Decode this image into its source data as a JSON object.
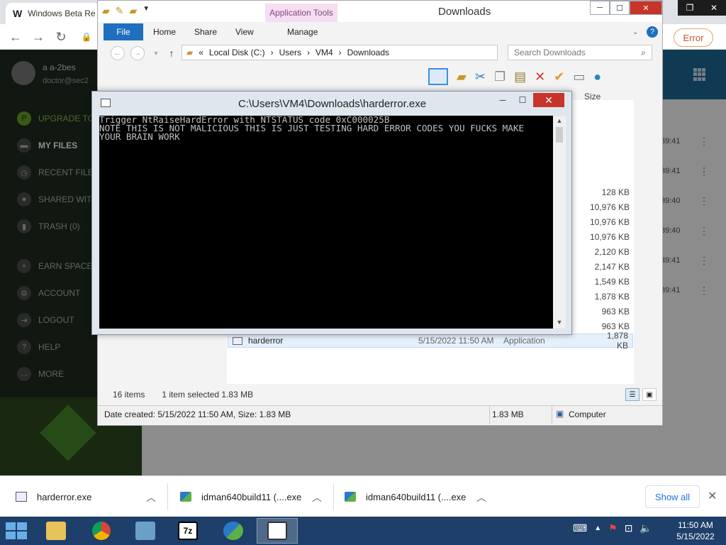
{
  "browser": {
    "tab_title": "Windows Beta Re",
    "error_label": "Error"
  },
  "sidebar": {
    "user_name": "a a-2bes",
    "user_email": "doctor@sec2",
    "items": [
      {
        "label": "Upgrade to",
        "icon": "upgrade-icon"
      },
      {
        "label": "My Files",
        "icon": "folder-icon"
      },
      {
        "label": "Recent Files",
        "icon": "clock-icon"
      },
      {
        "label": "Shared with",
        "icon": "people-icon"
      },
      {
        "label": "Trash (0)",
        "icon": "trash-icon"
      },
      {
        "label": "Earn Space",
        "icon": "plus-icon"
      },
      {
        "label": "Account",
        "icon": "gear-icon"
      },
      {
        "label": "Logout",
        "icon": "logout-icon"
      },
      {
        "label": "Help",
        "icon": "help-icon"
      },
      {
        "label": "More",
        "icon": "more-icon"
      }
    ]
  },
  "cloud_times": [
    "39:41",
    "39:41",
    "39:40",
    "39:40",
    "39:41",
    "39:41"
  ],
  "explorer": {
    "title": "Downloads",
    "app_tools": "Application Tools",
    "tabs": [
      "File",
      "Home",
      "Share",
      "View",
      "Manage"
    ],
    "breadcrumb": [
      "Local Disk (C:)",
      "Users",
      "VM4",
      "Downloads"
    ],
    "search_placeholder": "Search Downloads",
    "column_size": "Size",
    "sizes": [
      "128 KB",
      "10,976 KB",
      "10,976 KB",
      "10,976 KB",
      "2,120 KB",
      "2,147 KB",
      "1,549 KB",
      "1,878 KB",
      "963 KB",
      "963 KB"
    ],
    "selected_row": {
      "name": "harderror",
      "date": "5/15/2022 11:50 AM",
      "type": "Application",
      "size": "1,878 KB"
    },
    "status_items": "16 items",
    "status_selected": "1 item selected  1.83 MB",
    "detail_text": "Date created: 5/15/2022 11:50 AM, Size: 1.83 MB",
    "detail_size": "1.83 MB",
    "detail_location": "Computer"
  },
  "console": {
    "title": "C:\\Users\\VM4\\Downloads\\harderror.exe",
    "lines": [
      "Trigger NtRaiseHardError with NTSTATUS code 0xC000025B",
      "NOTE THIS IS NOT MALICIOUS THIS IS JUST TESTING HARD ERROR CODES YOU FUCKS MAKE",
      "YOUR BRAIN WORK"
    ]
  },
  "downloads": {
    "items": [
      "harderror.exe",
      "idman640build11 (....exe",
      "idman640build11 (....exe"
    ],
    "show_all": "Show all"
  },
  "taskbar": {
    "time": "11:50 AM",
    "date": "5/15/2022",
    "colors": {
      "bar": "#1d3f6a",
      "accent": "#6aaee8"
    }
  }
}
